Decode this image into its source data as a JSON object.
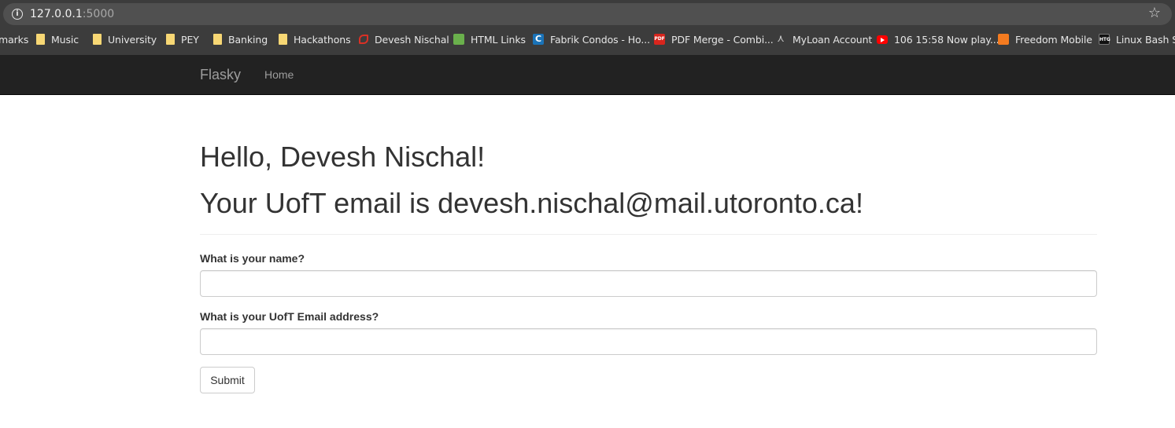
{
  "browser": {
    "url_host": "127.0.0.1",
    "url_port": ":5000",
    "info_icon": "info-icon",
    "star_icon": "star-icon"
  },
  "bookmarks": [
    {
      "label": "marks",
      "icon": "none"
    },
    {
      "label": "Music",
      "icon": "folder-icon"
    },
    {
      "label": "University",
      "icon": "folder-icon"
    },
    {
      "label": "PEY",
      "icon": "folder-icon"
    },
    {
      "label": "Banking",
      "icon": "folder-icon"
    },
    {
      "label": "Hackathons",
      "icon": "folder-icon"
    },
    {
      "label": "Devesh Nischal",
      "icon": "devesh-site-icon"
    },
    {
      "label": "HTML Links",
      "icon": "html-links-icon"
    },
    {
      "label": "Fabrik Condos - Ho...",
      "icon": "fabrik-icon"
    },
    {
      "label": "PDF Merge - Combi...",
      "icon": "pdf-icon"
    },
    {
      "label": "MyLoan Account",
      "icon": "myloan-icon"
    },
    {
      "label": "106 15:58 Now play...",
      "icon": "youtube-icon"
    },
    {
      "label": "Freedom Mobile",
      "icon": "freedom-icon"
    },
    {
      "label": "Linux Bash Sh",
      "icon": "htg-icon"
    }
  ],
  "icon_text": {
    "fabrik": "C",
    "pdf": "PDF",
    "myloan": "⋏",
    "htg": "HTG"
  },
  "navbar": {
    "brand": "Flasky",
    "home": "Home"
  },
  "page": {
    "greeting": "Hello, Devesh Nischal!",
    "email_line": "Your UofT email is devesh.nischal@mail.utoronto.ca!"
  },
  "form": {
    "name_label": "What is your name?",
    "name_value": "",
    "email_label": "What is your UofT Email address?",
    "email_value": "",
    "submit_label": "Submit"
  },
  "colors": {
    "navbar_bg": "#222222",
    "navbar_text": "#9d9d9d",
    "heading_text": "#333333",
    "chrome_bg": "#3c3c3c"
  }
}
